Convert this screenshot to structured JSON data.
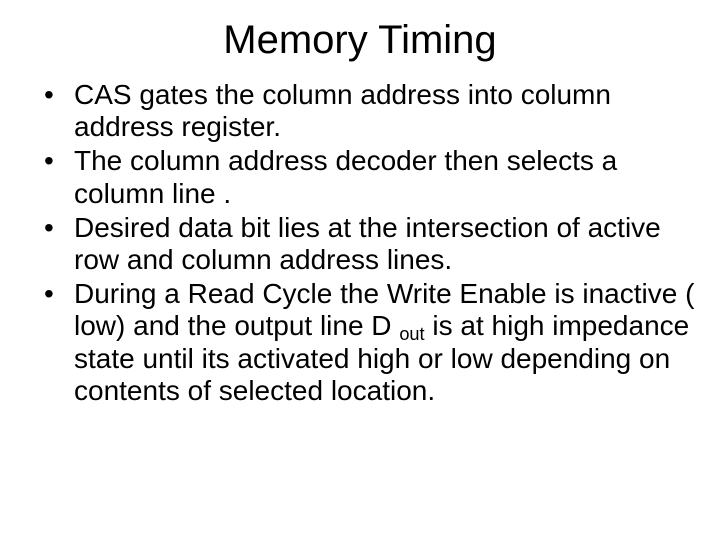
{
  "title": "Memory Timing",
  "bullets": [
    "CAS gates the column address into column address register.",
    "The column address decoder then selects a column line .",
    "Desired data bit lies at the intersection of active row and column address lines.",
    {
      "pre": "During  a Read Cycle the Write Enable is inactive ( low) and the output line D ",
      "sub": "out",
      "post": " is at high impedance state until its activated high or low depending on contents of selected location."
    }
  ]
}
